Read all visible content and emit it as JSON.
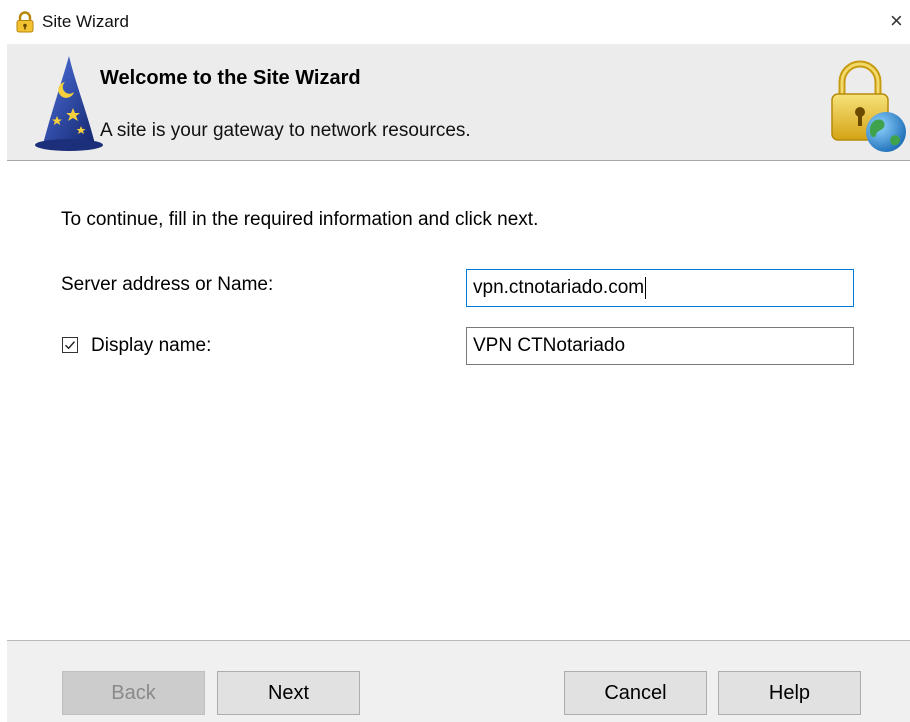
{
  "window": {
    "title": "Site Wizard",
    "close_glyph": "×",
    "icon": "lock-icon"
  },
  "header": {
    "title": "Welcome to the Site Wizard",
    "subtitle": "A site is your gateway to network resources.",
    "left_icon": "wizard-hat-icon",
    "right_icon": "lock-globe-icon"
  },
  "body": {
    "instructions": "To continue, fill in the required information and click next.",
    "server_label": "Server address or Name:",
    "server_value": "vpn.ctnotariado.com",
    "display_label": "Display name:",
    "display_checked": true,
    "display_value": "VPN CTNotariado"
  },
  "buttons": {
    "back": "Back",
    "next": "Next",
    "cancel": "Cancel",
    "help": "Help"
  },
  "colors": {
    "focus_border": "#0078d7",
    "header_bg": "#ececec",
    "footer_bg": "#f0f0f0"
  }
}
